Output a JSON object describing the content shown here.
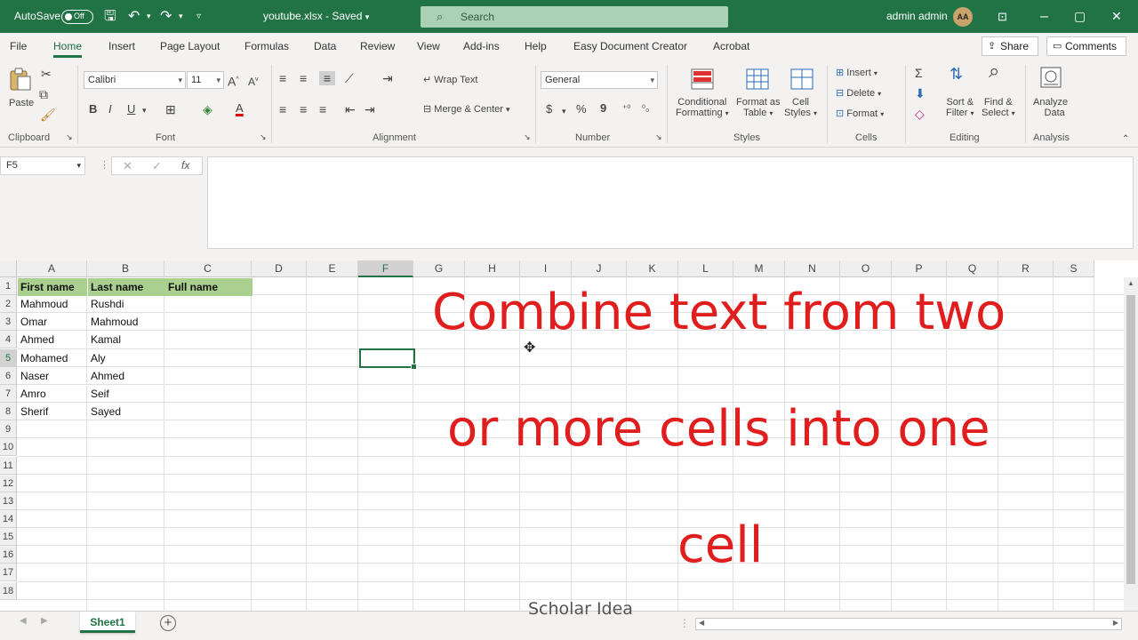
{
  "titlebar": {
    "autosave_label": "AutoSave",
    "autosave_state": "Off",
    "filename": "youtube.xlsx",
    "saved_status": "Saved",
    "search_placeholder": "Search",
    "user_name": "admin admin",
    "user_initials": "AA"
  },
  "menu": {
    "tabs": [
      "File",
      "Home",
      "Insert",
      "Page Layout",
      "Formulas",
      "Data",
      "Review",
      "View",
      "Add-ins",
      "Help",
      "Easy Document Creator",
      "Acrobat"
    ],
    "share_label": "Share",
    "comments_label": "Comments"
  },
  "ribbon": {
    "paste": "Paste",
    "font_name": "Calibri",
    "font_size": "11",
    "bold": "B",
    "italic": "I",
    "underline": "U",
    "wrap_text": "Wrap Text",
    "merge_center": "Merge & Center",
    "number_format": "General",
    "currency": "$",
    "percent": "%",
    "comma": "9",
    "conditional_formatting_1": "Conditional",
    "conditional_formatting_2": "Formatting",
    "format_as_table_1": "Format as",
    "format_as_table_2": "Table",
    "cell_styles_1": "Cell",
    "cell_styles_2": "Styles",
    "insert": "Insert",
    "delete": "Delete",
    "format": "Format",
    "sort_filter_1": "Sort &",
    "sort_filter_2": "Filter",
    "find_select_1": "Find &",
    "find_select_2": "Select",
    "analyze_1": "Analyze",
    "analyze_2": "Data",
    "groups": {
      "clipboard": "Clipboard",
      "font": "Font",
      "alignment": "Alignment",
      "number": "Number",
      "styles": "Styles",
      "cells": "Cells",
      "editing": "Editing",
      "analysis": "Analysis"
    }
  },
  "formula_bar": {
    "name_box": "F5",
    "formula": ""
  },
  "sheet": {
    "columns": [
      "A",
      "B",
      "C",
      "D",
      "E",
      "F",
      "G",
      "H",
      "I",
      "J",
      "K",
      "L",
      "M",
      "N",
      "O",
      "P",
      "Q",
      "R",
      "S"
    ],
    "rows": [
      "1",
      "2",
      "3",
      "4",
      "5",
      "6",
      "7",
      "8",
      "9",
      "10",
      "11",
      "12",
      "13",
      "14",
      "15",
      "16",
      "17",
      "18"
    ],
    "header_row": {
      "a": "First name",
      "b": "Last name",
      "c": "Full name"
    },
    "data": [
      {
        "first": "Mahmoud",
        "last": "Rushdi"
      },
      {
        "first": "Omar",
        "last": "Mahmoud"
      },
      {
        "first": "Ahmed",
        "last": "Kamal"
      },
      {
        "first": "Mohamed",
        "last": "Aly"
      },
      {
        "first": "Naser",
        "last": "Ahmed"
      },
      {
        "first": "Amro",
        "last": "Seif"
      },
      {
        "first": "Sherif",
        "last": "Sayed"
      }
    ],
    "selected_cell": "F5"
  },
  "overlay": {
    "line1": "Combine text from two",
    "line2": "or more cells into one",
    "line3": "cell",
    "color": "#e01e1e"
  },
  "bottom": {
    "sheet_tab": "Sheet1",
    "watermark": "Scholar Idea"
  },
  "colors": {
    "excel_green": "#217346",
    "header_fill": "#a9d08e"
  }
}
